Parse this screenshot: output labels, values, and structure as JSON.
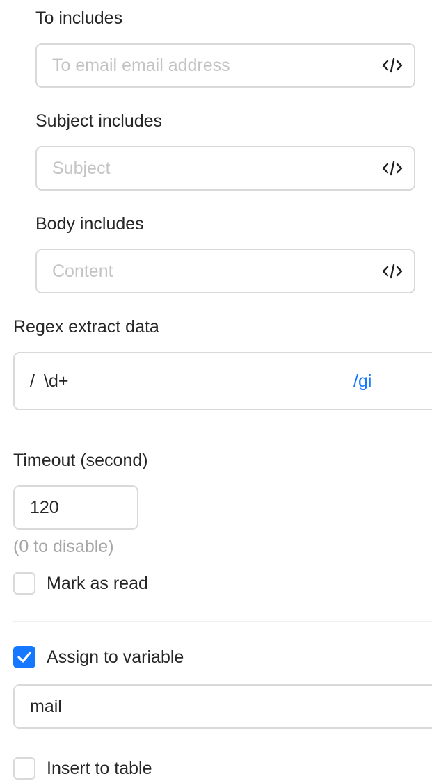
{
  "filters": {
    "to": {
      "label": "To includes",
      "placeholder": "To email email address"
    },
    "subject": {
      "label": "Subject includes",
      "placeholder": "Subject"
    },
    "body": {
      "label": "Body includes",
      "placeholder": "Content"
    }
  },
  "regex": {
    "label": "Regex extract data",
    "prefix": "/",
    "value": "\\d+",
    "flags": "/gi"
  },
  "timeout": {
    "label": "Timeout (second)",
    "value": "120",
    "hint": "(0 to disable)"
  },
  "mark_as_read": {
    "label": "Mark as read",
    "checked": false
  },
  "assign_variable": {
    "label": "Assign to variable",
    "checked": true,
    "value": "mail"
  },
  "insert_table": {
    "label": "Insert to table",
    "checked": false
  },
  "icons": {
    "code": "code-icon",
    "check": "checkmark-icon"
  },
  "colors": {
    "accent": "#1677ff",
    "border": "#d9d9d9",
    "placeholder": "#c4c4c4",
    "hint": "#a6a6a6"
  }
}
